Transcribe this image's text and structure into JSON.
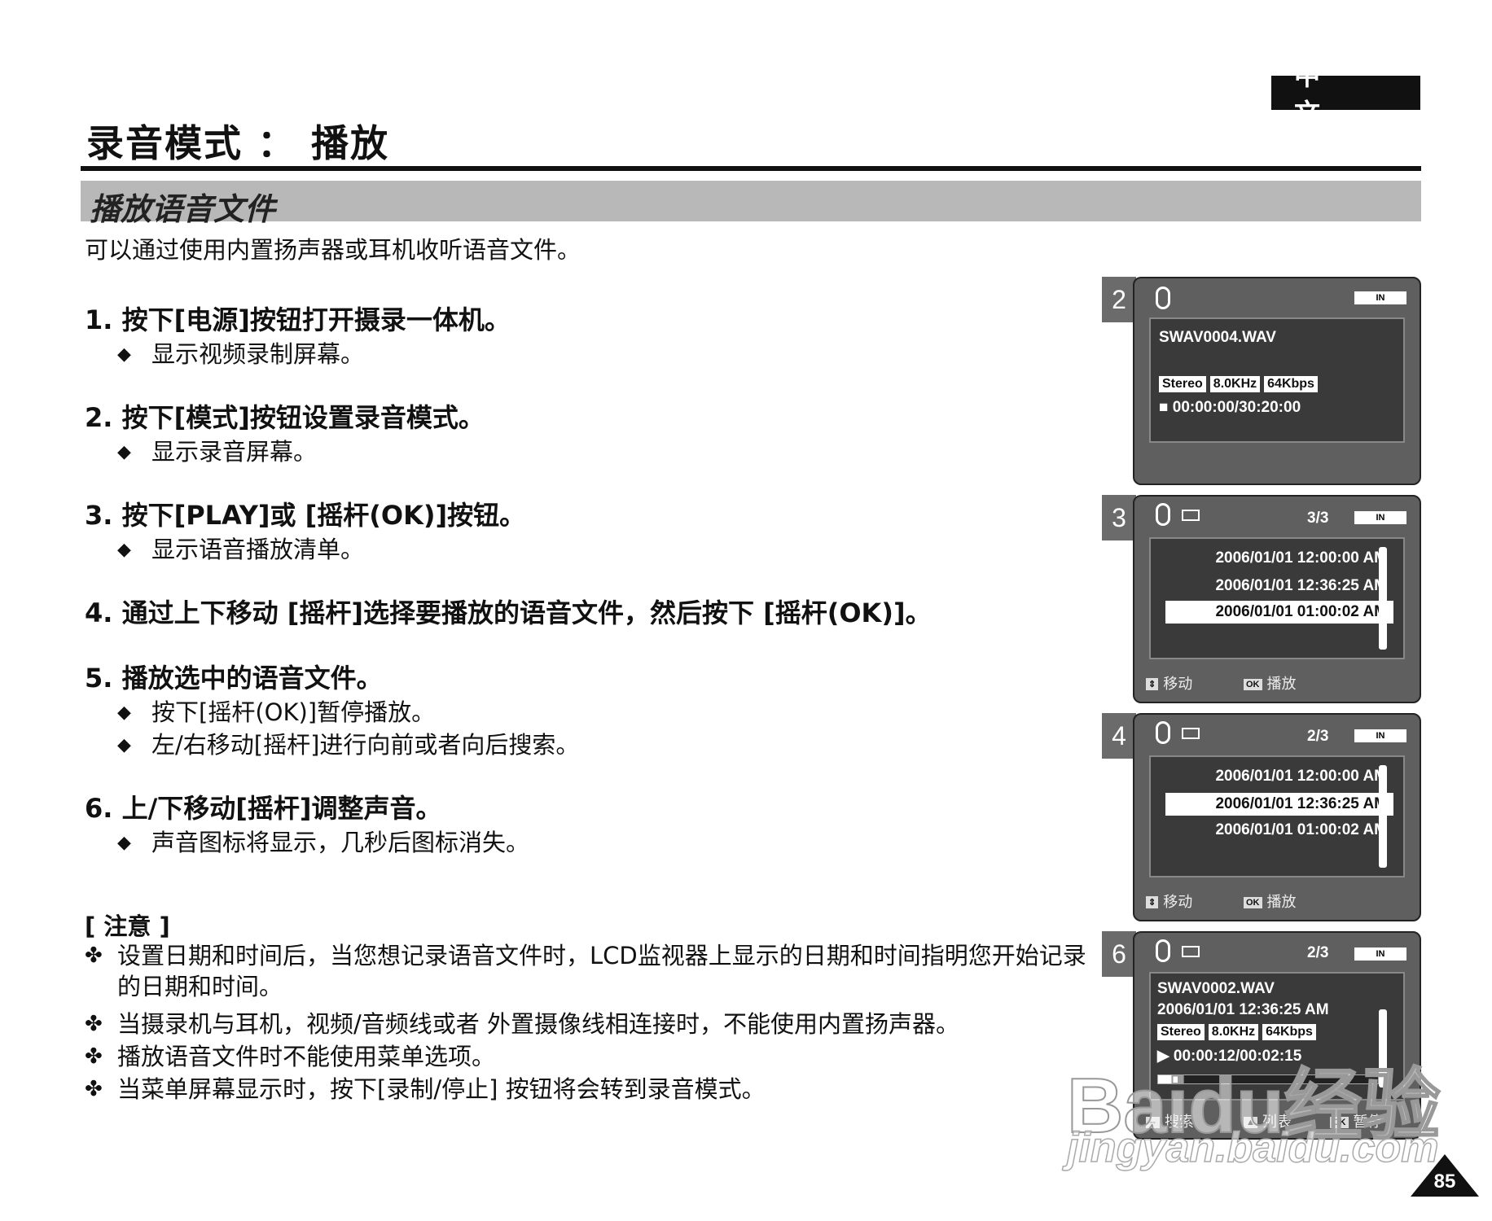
{
  "header": {
    "language_badge": "中 文",
    "page_title": "录音模式 ： 播放"
  },
  "section": {
    "title": "播放语音文件",
    "intro": "可以通过使用内置扬声器或耳机收听语音文件。"
  },
  "steps": [
    {
      "title": "1. 按下[电源]按钮打开摄录一体机。",
      "bullets": [
        "显示视频录制屏幕。"
      ]
    },
    {
      "title": "2. 按下[模式]按钮设置录音模式。",
      "bullets": [
        "显示录音屏幕。"
      ]
    },
    {
      "title": "3.  按下[PLAY]或 [摇杆(OK)]按钮。",
      "bullets": [
        "显示语音播放清单。"
      ]
    },
    {
      "title": "4. 通过上下移动 [摇杆]选择要播放的语音文件，然后按下 [摇杆(OK)]。",
      "bullets": []
    },
    {
      "title": "5. 播放选中的语音文件。",
      "bullets": [
        "按下[摇杆(OK)]暂停播放。",
        "左/右移动[摇杆]进行向前或者向后搜索。"
      ]
    },
    {
      "title": "6. 上/下移动[摇杆]调整声音。",
      "bullets": [
        "声音图标将显示，几秒后图标消失。"
      ]
    }
  ],
  "notes": {
    "heading": "[ 注意 ]",
    "items": [
      "设置日期和时间后，当您想记录语音文件时，LCD监视器上显示的日期和时间指明您开始记录的日期和时间。",
      "当摄录机与耳机，视频/音频线或者 外置摄像线相连接时，不能使用内置扬声器。",
      "播放语音文件时不能使用菜单选项。",
      "当菜单屏幕显示时，按下[录制/停止] 按钮将会转到录音模式。"
    ]
  },
  "screens": {
    "s2": {
      "tab": "2",
      "battery": "IN",
      "filename": "SWAV0004.WAV",
      "badges": [
        "Stereo",
        "8.0KHz",
        "64Kbps"
      ],
      "time": "■ 00:00:00/30:20:00"
    },
    "s3": {
      "tab": "3",
      "counter": "3/3",
      "battery": "IN",
      "rows": [
        "2006/01/01 12:00:00 AM",
        "2006/01/01 12:36:25 AM",
        "2006/01/01 01:00:02 AM"
      ],
      "selected": 2,
      "footer": {
        "move": "移动",
        "play": "播放",
        "ok_key": "OK"
      }
    },
    "s4": {
      "tab": "4",
      "counter": "2/3",
      "battery": "IN",
      "rows": [
        "2006/01/01 12:00:00 AM",
        "2006/01/01 12:36:25 AM",
        "2006/01/01 01:00:02 AM"
      ],
      "selected": 1,
      "footer": {
        "move": "移动",
        "play": "播放",
        "ok_key": "OK"
      }
    },
    "s6": {
      "tab": "6",
      "counter": "2/3",
      "battery": "IN",
      "filename": "SWAV0002.WAV",
      "datetime": "2006/01/01 12:36:25 AM",
      "badges": [
        "Stereo",
        "8.0KHz",
        "64Kbps"
      ],
      "time": "▶ 00:00:12/00:02:15",
      "progress": 0.09,
      "footer": {
        "search": "搜索",
        "list": "列表",
        "pause": "暂停",
        "ok_key": "OK"
      }
    }
  },
  "watermark": {
    "brand": "Baidu经验",
    "url": "jingyan.baidu.com"
  },
  "page_number": "85"
}
